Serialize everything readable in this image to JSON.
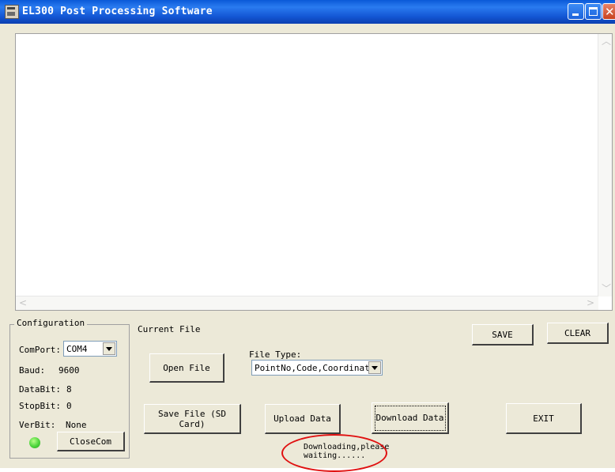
{
  "window": {
    "title": "EL300 Post Processing Software"
  },
  "configuration": {
    "title": "Configuration",
    "comport_label": "ComPort:",
    "comport_value": "COM4",
    "baud_label": "Baud:",
    "baud_value": "9600",
    "databit_label": "DataBit:",
    "databit_value": "8",
    "stopbit_label": "StopBit:",
    "stopbit_value": "0",
    "verbit_label": "VerBit:",
    "verbit_value": "None",
    "close_button": "CloseCom",
    "status_color": "#4cd43c"
  },
  "file": {
    "current_file_label": "Current File",
    "file_type_label": "File Type:",
    "file_type_value": "PointNo,Code,Coordinate"
  },
  "buttons": {
    "open_file": "Open File",
    "save_file_sd": "Save File (SD Card)",
    "upload": "Upload Data",
    "download": "Download Data",
    "exit": "EXIT",
    "save": "SAVE",
    "clear": "CLEAR"
  },
  "status": {
    "line1": "Downloading,please",
    "line2": "waiting......",
    "highlight_color": "#e01010"
  }
}
